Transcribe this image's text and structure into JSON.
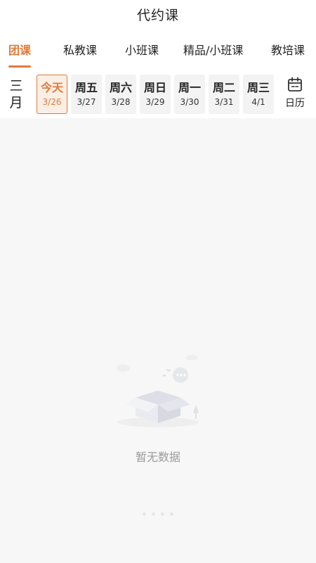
{
  "header": {
    "title": "代约课"
  },
  "tabs": [
    {
      "label": "团课",
      "active": true
    },
    {
      "label": "私教课",
      "active": false
    },
    {
      "label": "小班课",
      "active": false
    },
    {
      "label": "精品/小班课",
      "active": false
    },
    {
      "label": "教培课",
      "active": false
    }
  ],
  "datebar": {
    "month": "三月",
    "days": [
      {
        "weekday": "今天",
        "date": "3/26",
        "active": true
      },
      {
        "weekday": "周五",
        "date": "3/27",
        "active": false
      },
      {
        "weekday": "周六",
        "date": "3/28",
        "active": false
      },
      {
        "weekday": "周日",
        "date": "3/29",
        "active": false
      },
      {
        "weekday": "周一",
        "date": "3/30",
        "active": false
      },
      {
        "weekday": "周二",
        "date": "3/31",
        "active": false
      },
      {
        "weekday": "周三",
        "date": "4/1",
        "active": false
      }
    ],
    "calendar_label": "日历",
    "calendar_icon": "calendar-icon"
  },
  "empty": {
    "text": "暂无数据",
    "icon": "empty-box-icon"
  },
  "colors": {
    "accent": "#e07a3a",
    "content_bg": "#f7f7f7",
    "day_bg": "#f3f3f3"
  }
}
